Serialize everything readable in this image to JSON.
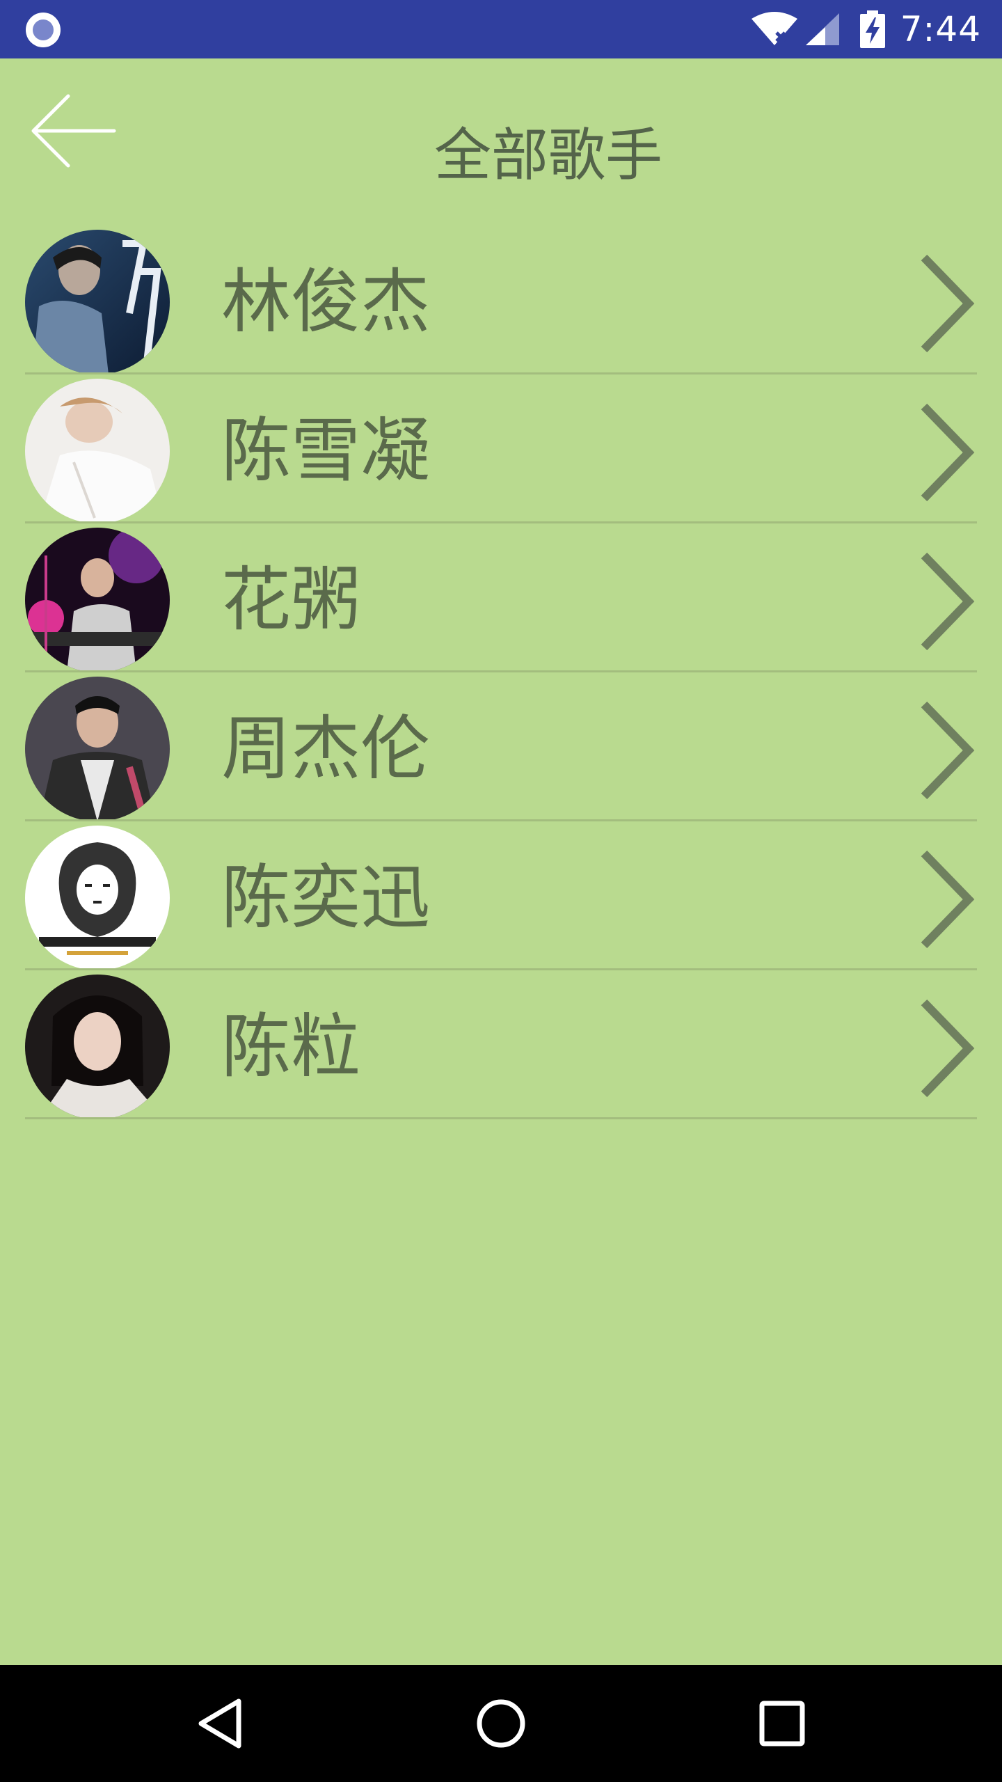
{
  "status_bar": {
    "time": "7:44",
    "icons": [
      "notification-circle-icon",
      "wifi-off-icon",
      "signal-icon",
      "battery-charging-icon"
    ],
    "background": "#303f9f"
  },
  "header": {
    "title": "全部歌手",
    "back_icon": "arrow-left-icon"
  },
  "singers": [
    {
      "name": "林俊杰"
    },
    {
      "name": "陈雪凝"
    },
    {
      "name": "花粥"
    },
    {
      "name": "周杰伦"
    },
    {
      "name": "陈奕迅"
    },
    {
      "name": "陈粒"
    }
  ],
  "nav_bar": {
    "buttons": [
      "back-triangle-icon",
      "home-circle-icon",
      "recents-square-icon"
    ]
  },
  "colors": {
    "background": "#b9da8f",
    "text": "#5a6a4b",
    "divider": "#a3bd7e"
  }
}
